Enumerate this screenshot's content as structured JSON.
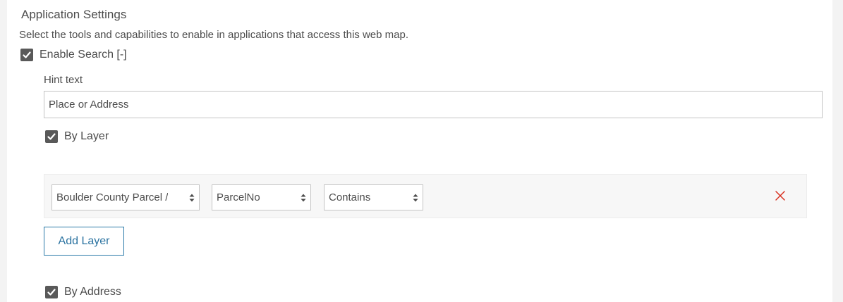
{
  "section": {
    "title": "Application Settings",
    "description": "Select the tools and capabilities to enable in applications that access this web map."
  },
  "enable_search": {
    "label": "Enable Search [-]",
    "checked": true
  },
  "hint": {
    "label": "Hint text",
    "value": "Place or Address"
  },
  "by_layer": {
    "label": "By Layer",
    "checked": true
  },
  "layer_row": {
    "layer_select": "Boulder County Parcel /",
    "field_select": "ParcelNo",
    "operator_select": "Contains",
    "remove_icon": "close-icon"
  },
  "add_layer": {
    "label": "Add Layer"
  },
  "by_address": {
    "label": "By Address",
    "checked": true
  },
  "colors": {
    "accent": "#2a72a0",
    "remove": "#d83020",
    "checkbox": "#595959"
  }
}
